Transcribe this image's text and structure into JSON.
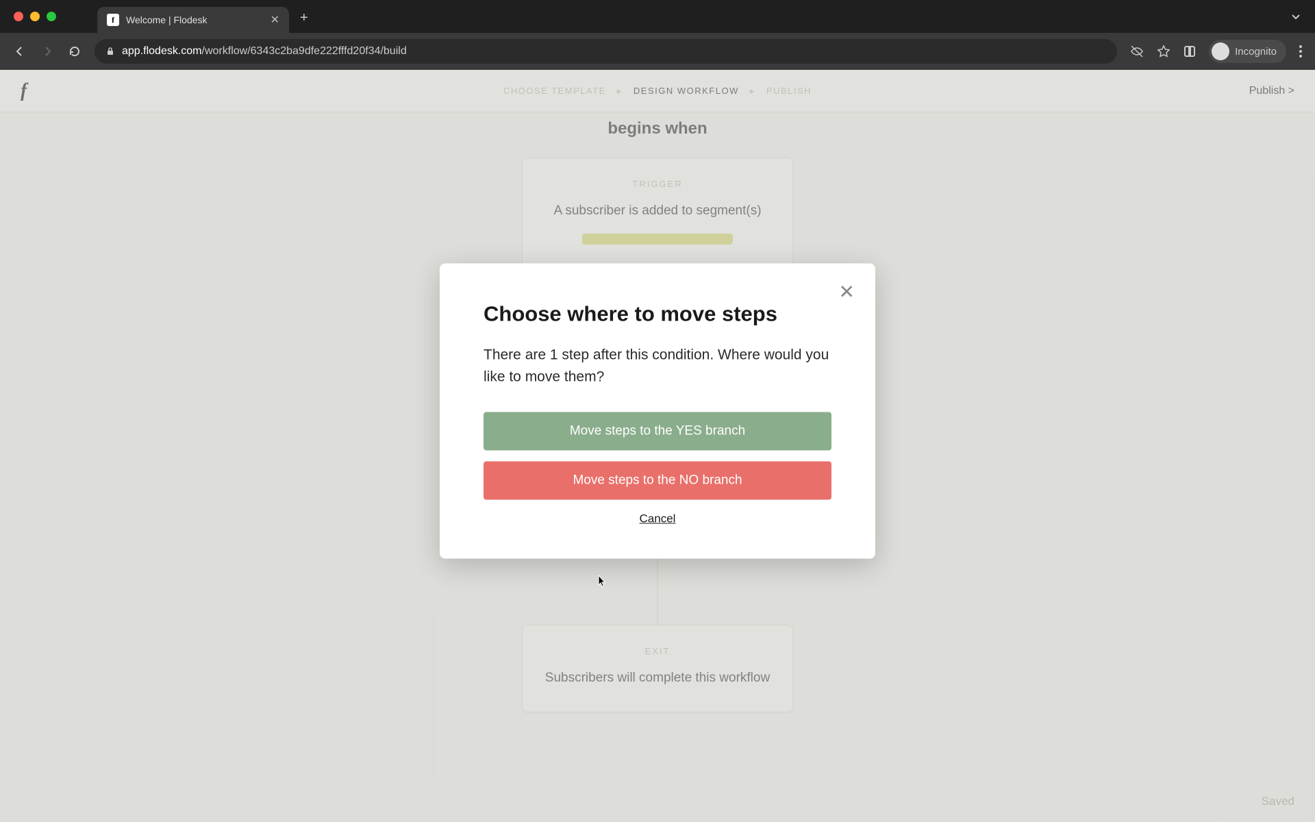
{
  "browser": {
    "tab_title": "Welcome | Flodesk",
    "url_host": "app.flodesk.com",
    "url_path": "/workflow/6343c2ba9dfe222fffd20f34/build",
    "incognito_label": "Incognito"
  },
  "header": {
    "logo": "f",
    "breadcrumbs": {
      "step1": "CHOOSE TEMPLATE",
      "step2": "DESIGN WORKFLOW",
      "step3": "PUBLISH",
      "sep": "▸"
    },
    "publish_label": "Publish >"
  },
  "canvas": {
    "begins_when": "begins when",
    "trigger": {
      "label": "TRIGGER",
      "body": "A subscriber is added to segment(s)"
    },
    "exit": {
      "label": "EXIT",
      "body": "Subscribers will complete this workflow"
    },
    "saved_label": "Saved"
  },
  "modal": {
    "title": "Choose where to move steps",
    "body": "There are 1 step after this condition. Where would you like to move them?",
    "yes_label": "Move steps to the YES branch",
    "no_label": "Move steps to the NO branch",
    "cancel_label": "Cancel"
  },
  "colors": {
    "yes_btn": "#8aad8c",
    "no_btn": "#e96f6a",
    "segment_pill": "#d9d96b"
  }
}
